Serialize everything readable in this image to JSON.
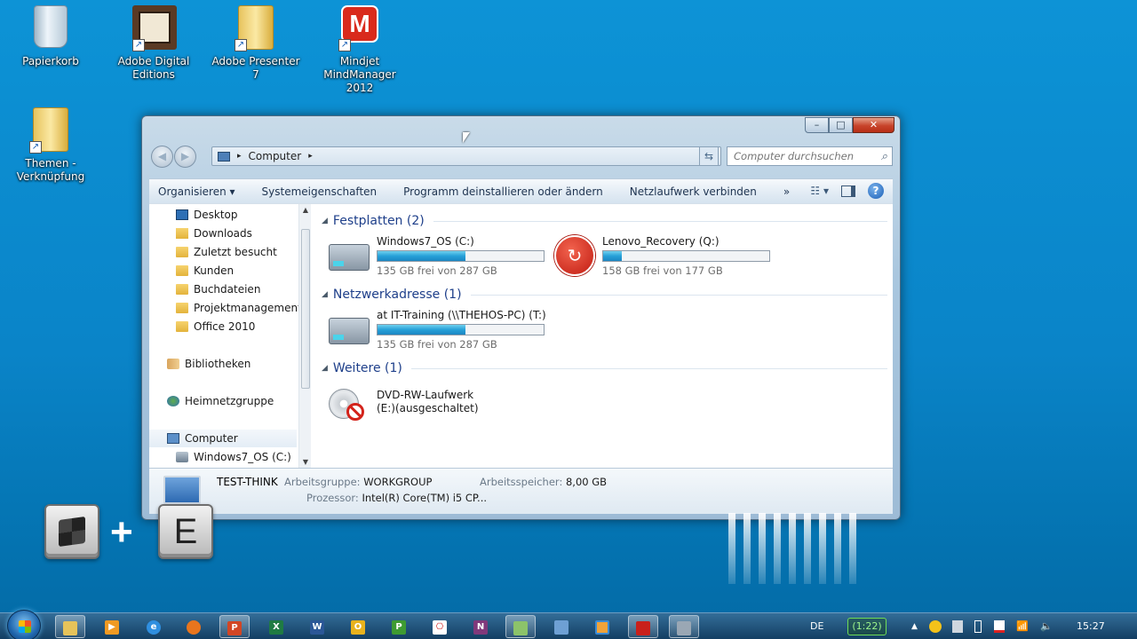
{
  "desktop": {
    "icons": [
      {
        "label": "Papierkorb"
      },
      {
        "label": "Adobe Digital Editions"
      },
      {
        "label": "Adobe Presenter 7"
      },
      {
        "label": "Mindjet MindManager 2012"
      },
      {
        "label": "Themen - Verknüpfung"
      }
    ]
  },
  "window": {
    "minimize": "–",
    "maximize": "□",
    "close": "✕",
    "address": {
      "segments": [
        "Computer"
      ],
      "separator": "▸"
    },
    "search_placeholder": "Computer durchsuchen",
    "toolbar": {
      "organize": "Organisieren ▾",
      "system_properties": "Systemeigenschaften",
      "uninstall": "Programm deinstallieren oder ändern",
      "map_drive": "Netzlaufwerk verbinden",
      "more": "»"
    },
    "nav": {
      "favorites": [
        "Desktop",
        "Downloads",
        "Zuletzt besucht",
        "Kunden",
        "Buchdateien",
        "Projektmanagement",
        "Office 2010"
      ],
      "libraries": "Bibliotheken",
      "homegroup": "Heimnetzgruppe",
      "computer": "Computer",
      "computer_child": "Windows7_OS (C:)"
    },
    "groups": {
      "hard_drives": "Festplatten (2)",
      "network": "Netzwerkadresse (1)",
      "other": "Weitere (1)"
    },
    "drives": [
      {
        "name": "Windows7_OS (C:)",
        "free": "135 GB frei von 287 GB",
        "used_fraction": 0.53
      },
      {
        "name": "Lenovo_Recovery (Q:)",
        "free": "158 GB frei von 177 GB",
        "used_fraction": 0.11
      },
      {
        "name": "at IT-Training (\\\\THEHOS-PC) (T:)",
        "free": "135 GB frei von 287 GB",
        "used_fraction": 0.53
      }
    ],
    "dvd": {
      "line1": "DVD-RW-Laufwerk",
      "line2": "(E:)(ausgeschaltet)"
    },
    "details": {
      "computer_name": "TEST-THINK",
      "workgroup_label": "Arbeitsgruppe:",
      "workgroup_value": "WORKGROUP",
      "memory_label": "Arbeitsspeicher:",
      "memory_value": "8,00 GB",
      "cpu_label": "Prozessor:",
      "cpu_value": "Intel(R) Core(TM) i5 CP..."
    }
  },
  "overlay": {
    "plus": "+",
    "key_e": "E"
  },
  "taskbar": {
    "language": "DE",
    "battery": "(1:22)",
    "clock": "15:27",
    "apps": [
      "explorer",
      "media-player",
      "internet-explorer",
      "firefox",
      "P",
      "X",
      "W",
      "O",
      "P",
      "pdf",
      "N",
      "photo",
      "window",
      "chat",
      "acrobat-red",
      "tools"
    ]
  },
  "colors": {
    "accent": "#1e3f8a",
    "progress": "#26a0d8",
    "desktop": "#0a84c8"
  }
}
